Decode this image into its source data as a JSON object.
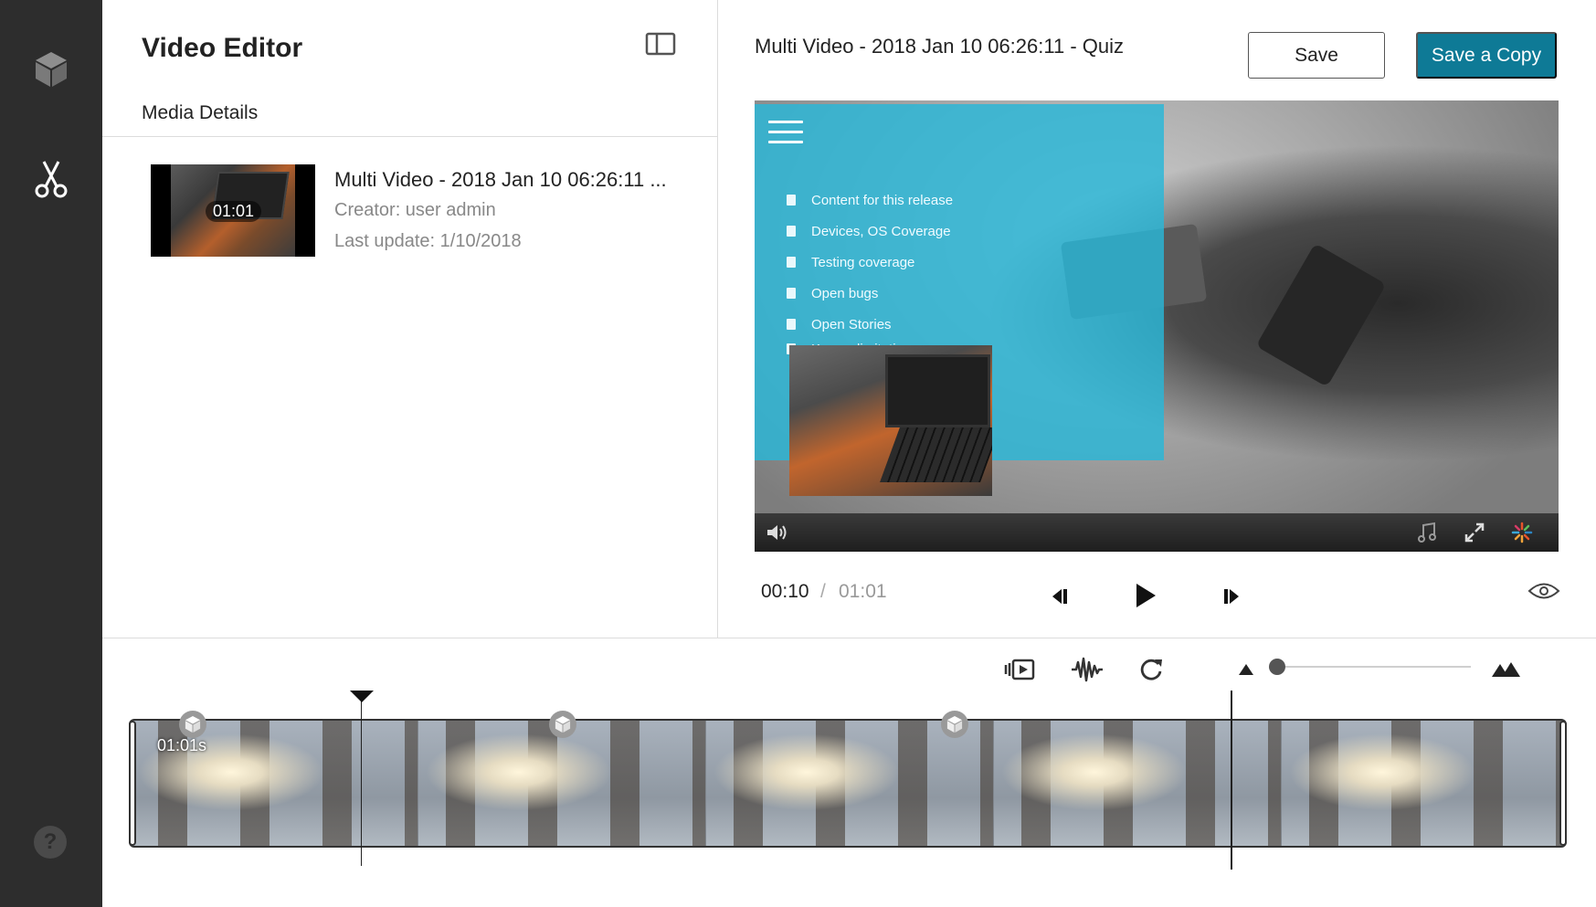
{
  "sidebar": {
    "items": [
      {
        "icon": "cube-icon"
      },
      {
        "icon": "scissors-icon"
      }
    ],
    "help_label": "?"
  },
  "editor": {
    "title": "Video Editor",
    "media_details_label": "Media Details"
  },
  "media": {
    "name": "Multi Video - 2018 Jan 10 06:26:11 ...",
    "duration": "01:01",
    "creator": "Creator: user admin",
    "last_update": "Last update: 1/10/2018"
  },
  "player": {
    "title": "Multi Video - 2018 Jan 10 06:26:11 - Quiz",
    "save_label": "Save",
    "save_copy_label": "Save a Copy",
    "slide_items": [
      "Content for this release",
      "Devices, OS Coverage",
      "Testing coverage",
      "Open bugs",
      "Open Stories",
      "Known limitation"
    ],
    "current_time": "00:10",
    "separator": "/",
    "total_time": "01:01"
  },
  "timeline": {
    "clip_label": "01:01s",
    "zoom_level": 0.0
  },
  "colors": {
    "accent": "#0e7a96",
    "rail": "#2d2d2d",
    "slide_overlay": "#28b7d8"
  }
}
